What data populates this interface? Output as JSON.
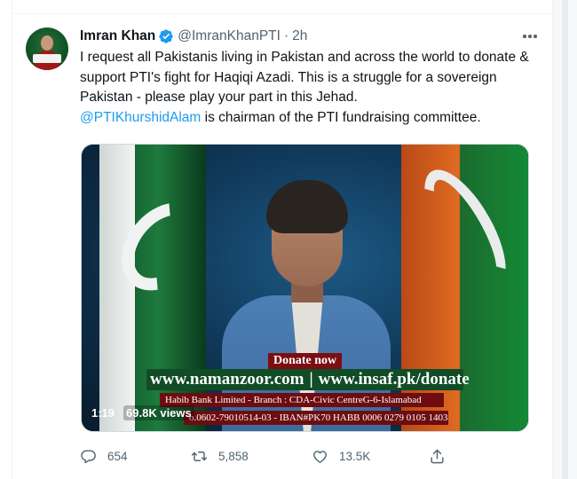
{
  "tweet": {
    "author": {
      "display_name": "Imran Khan",
      "handle": "@ImranKhanPTI",
      "separator": "·",
      "time": "2h",
      "verified": true,
      "avatar_icon": "profile-photo"
    },
    "text_lines": [
      "I request all Pakistanis living in Pakistan and across the world to donate &",
      "support PTI's fight for Haqiqi Azadi. This is a struggle for a sovereign",
      "Pakistan - please play your part in this Jehad."
    ],
    "mention": "@PTIKhurshidAlam",
    "mention_rest": " is chairman of the PTI fundraising committee.",
    "video": {
      "overlay": {
        "donate_label": "Donate now",
        "url_1": "www.namanzoor.com",
        "url_separator": "|",
        "url_2": "www.insaf.pk/donate",
        "bank_line": "Habib Bank Limited - Branch : CDA-Civic CentreG-6-Islamabad",
        "iban_line": "o.0602-79010514-03 - IBAN#PK70 HABB 0006 0279 0105 1403"
      },
      "duration": "1:19",
      "views": "69.8K views"
    },
    "actions": {
      "replies": "654",
      "retweets": "5,858",
      "likes": "13.5K"
    },
    "colors": {
      "accent": "#1d9bf0",
      "secondary_text": "#536471",
      "primary_text": "#0f1419"
    }
  }
}
